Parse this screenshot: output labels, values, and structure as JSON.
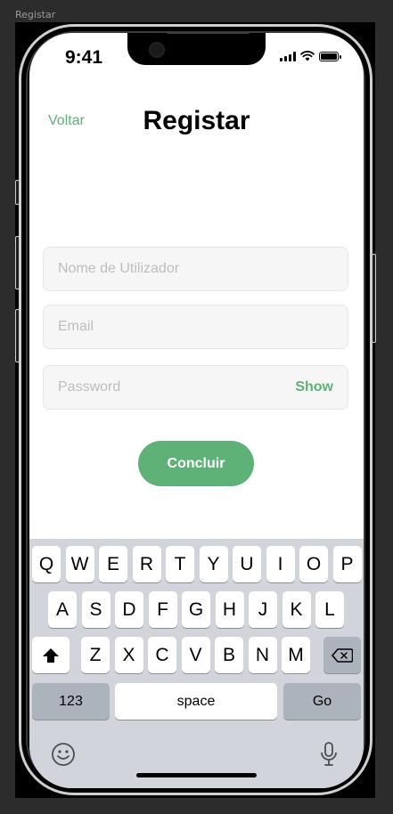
{
  "frame_label": "Registar",
  "status_bar": {
    "time": "9:41"
  },
  "nav": {
    "back_label": "Voltar",
    "title": "Registar"
  },
  "form": {
    "username_placeholder": "Nome de Utilizador",
    "email_placeholder": "Email",
    "password_placeholder": "Password",
    "show_label": "Show",
    "submit_label": "Concluir"
  },
  "keyboard": {
    "row1": [
      "Q",
      "W",
      "E",
      "R",
      "T",
      "Y",
      "U",
      "I",
      "O",
      "P"
    ],
    "row2": [
      "A",
      "S",
      "D",
      "F",
      "G",
      "H",
      "J",
      "K",
      "L"
    ],
    "row3": [
      "Z",
      "X",
      "C",
      "V",
      "B",
      "N",
      "M"
    ],
    "numbers_label": "123",
    "space_label": "space",
    "go_label": "Go"
  },
  "colors": {
    "accent": "#5eb277",
    "field_bg": "#f6f6f6",
    "keyboard_bg": "#d1d4da"
  }
}
